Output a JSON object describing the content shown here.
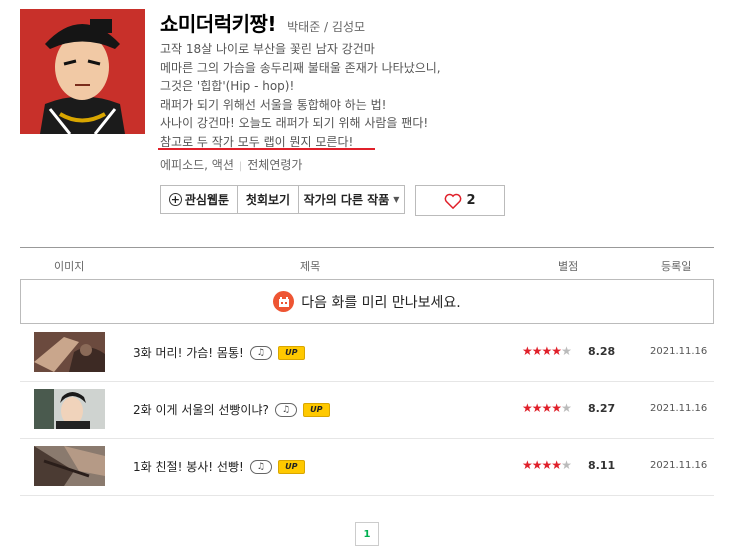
{
  "webtoon": {
    "title": "쇼미더럭키짱!",
    "authors": "박태준 / 김성모",
    "synopsis": [
      "고작 18살 나이로 부산을 꽃린 남자 강건마",
      "메마른 그의 가슴을 송두리째 불태울 존재가 나타났으니,",
      "그것은 '힙합'(Hip - hop)!",
      "래퍼가 되기 위해선 서울을 통합해야 하는 법!",
      "사나이 강건마! 오늘도 래퍼가 되기 위해 사람을 팬다!",
      "참고로 두 작가 모두 랩이 뭔지 모른다!"
    ],
    "genre": "에피소드, 액션",
    "age_rating": "전체연령가",
    "colors": {
      "accent": "#e0202a",
      "badge_up": "#ffc900",
      "pagination": "#00b050"
    }
  },
  "buttons": {
    "interest": "관심웹툰",
    "first_view": "첫회보기",
    "other_works": "작가의 다른 작품",
    "like_count": "2"
  },
  "table": {
    "headers": {
      "image": "이미지",
      "title": "제목",
      "rating": "별점",
      "date": "등록일"
    },
    "preview_text": "다음 화를 미리 만나보세요.",
    "episodes": [
      {
        "title": "3화 머리! 가슴! 몸통!",
        "rating": "8.28",
        "stars": 4,
        "date": "2021.11.16",
        "badge": "UP"
      },
      {
        "title": "2화 이게 서울의 선빵이냐?",
        "rating": "8.27",
        "stars": 4,
        "date": "2021.11.16",
        "badge": "UP"
      },
      {
        "title": "1화 친절! 봉사! 선빵!",
        "rating": "8.11",
        "stars": 4,
        "date": "2021.11.16",
        "badge": "UP"
      }
    ]
  },
  "pagination": {
    "current": "1"
  }
}
